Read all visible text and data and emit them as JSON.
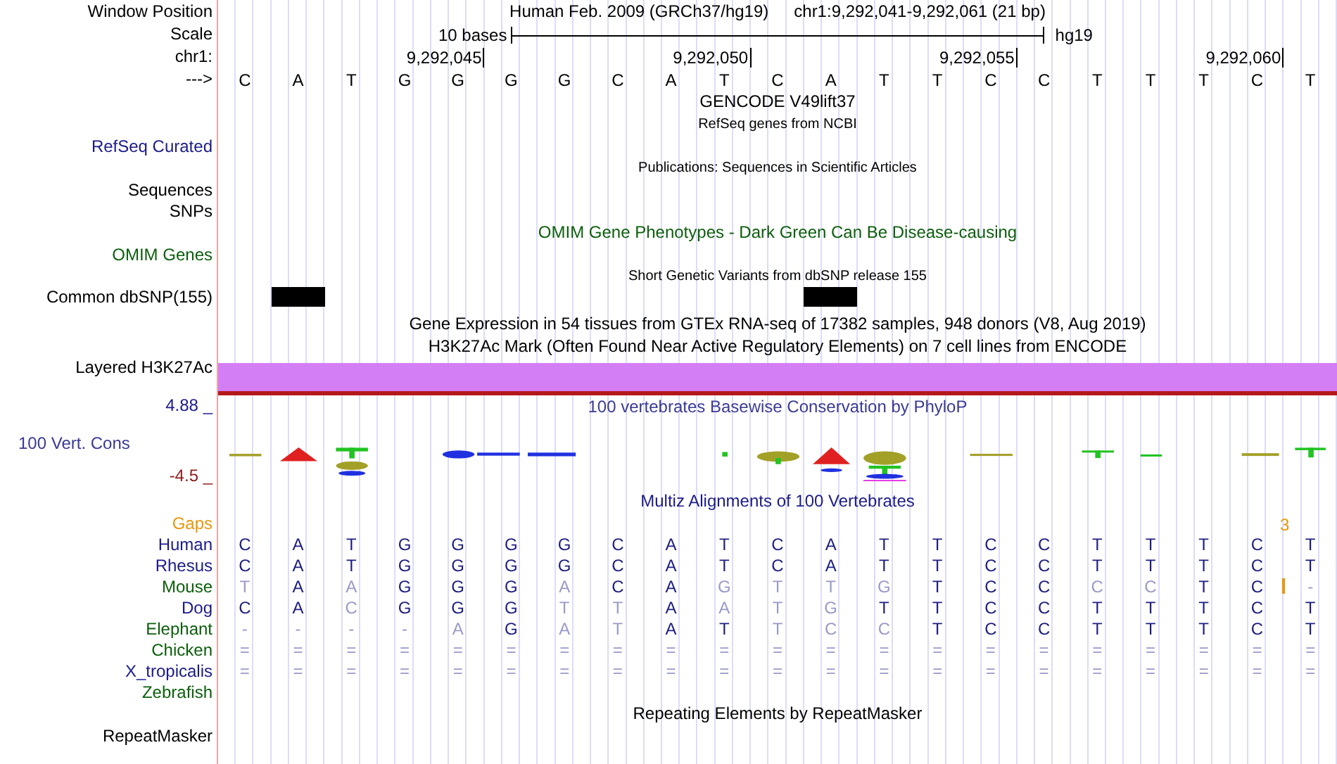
{
  "header": {
    "labels": {
      "window_position": "Window Position",
      "scale": "Scale",
      "chromosome": "chr1:",
      "strand": "--->"
    },
    "assembly": "Human Feb. 2009 (GRCh37/hg19)",
    "position": "chr1:9,292,041-9,292,061 (21 bp)",
    "scale_text": "10 bases",
    "scale_assembly": "hg19",
    "ticks": [
      "9,292,045",
      "9,292,050",
      "9,292,055",
      "9,292,060"
    ],
    "bases": [
      "C",
      "A",
      "T",
      "G",
      "G",
      "G",
      "G",
      "C",
      "A",
      "T",
      "C",
      "A",
      "T",
      "T",
      "C",
      "C",
      "T",
      "T",
      "T",
      "C",
      "T"
    ]
  },
  "tracks": [
    {
      "kind": "title",
      "text": "GENCODE V49lift37",
      "color": "#000000"
    },
    {
      "kind": "subtitle",
      "text": "RefSeq genes from NCBI",
      "color": "#000000"
    },
    {
      "kind": "label",
      "label": "RefSeq Curated",
      "color": "#1b1b8a"
    },
    {
      "kind": "subtitle",
      "text": "Publications: Sequences in Scientific Articles",
      "color": "#000000"
    },
    {
      "kind": "label",
      "label": "Sequences",
      "color": "#000000"
    },
    {
      "kind": "label",
      "label": "SNPs",
      "color": "#000000"
    },
    {
      "kind": "title",
      "text": "OMIM Gene Phenotypes - Dark Green Can Be Disease-causing",
      "color": "#0b5e0b"
    },
    {
      "kind": "label",
      "label": "OMIM Genes",
      "color": "#0b5e0b"
    },
    {
      "kind": "subtitle",
      "text": "Short Genetic Variants from dbSNP release 155",
      "color": "#000000"
    },
    {
      "kind": "snp",
      "label": "Common dbSNP(155)",
      "color": "#000000",
      "variants": [
        {
          "variant": false
        },
        {
          "variant": true
        },
        {
          "variant": false
        },
        {
          "variant": false
        },
        {
          "variant": false
        },
        {
          "variant": false
        },
        {
          "variant": false
        },
        {
          "variant": false
        },
        {
          "variant": false
        },
        {
          "variant": false
        },
        {
          "variant": false
        },
        {
          "variant": true
        },
        {
          "variant": false
        },
        {
          "variant": false
        },
        {
          "variant": false
        },
        {
          "variant": false
        },
        {
          "variant": false
        },
        {
          "variant": false
        },
        {
          "variant": false
        },
        {
          "variant": false
        },
        {
          "variant": false
        }
      ]
    },
    {
      "kind": "title",
      "text": "Gene Expression in 54 tissues from GTEx RNA-seq of 17382 samples, 948 donors (V8, Aug 2019)",
      "color": "#000000"
    },
    {
      "kind": "title",
      "text": "H3K27Ac Mark (Often Found Near Active Regulatory Elements) on 7 cell lines from ENCODE",
      "color": "#000000"
    },
    {
      "kind": "signal",
      "label": "Layered H3K27Ac",
      "color": "#000000"
    },
    {
      "kind": "conservation",
      "label": "100 Vert. Cons",
      "color": "#3a3a96",
      "title": "100 vertebrates Basewise Conservation by PhyloP",
      "max": "4.88 _",
      "min": "-4.5 _"
    },
    {
      "kind": "title",
      "text": "Multiz Alignments of 100 Vertebrates",
      "color": "#1b1b8a"
    },
    {
      "kind": "gaps",
      "label": "Gaps",
      "color": "#e8960c",
      "marker": "3"
    },
    {
      "kind": "species",
      "label": "Human",
      "color": "#1b1b8a",
      "insertion": false,
      "bases": [
        {
          "base": "C",
          "match": true
        },
        {
          "base": "A",
          "match": true
        },
        {
          "base": "T",
          "match": true
        },
        {
          "base": "G",
          "match": true
        },
        {
          "base": "G",
          "match": true
        },
        {
          "base": "G",
          "match": true
        },
        {
          "base": "G",
          "match": true
        },
        {
          "base": "C",
          "match": true
        },
        {
          "base": "A",
          "match": true
        },
        {
          "base": "T",
          "match": true
        },
        {
          "base": "C",
          "match": true
        },
        {
          "base": "A",
          "match": true
        },
        {
          "base": "T",
          "match": true
        },
        {
          "base": "T",
          "match": true
        },
        {
          "base": "C",
          "match": true
        },
        {
          "base": "C",
          "match": true
        },
        {
          "base": "T",
          "match": true
        },
        {
          "base": "T",
          "match": true
        },
        {
          "base": "T",
          "match": true
        },
        {
          "base": "C",
          "match": true
        },
        {
          "base": "T",
          "match": true
        }
      ]
    },
    {
      "kind": "species",
      "label": "Rhesus",
      "color": "#1b1b8a",
      "insertion": false,
      "bases": [
        {
          "base": "C",
          "match": true
        },
        {
          "base": "A",
          "match": true
        },
        {
          "base": "T",
          "match": true
        },
        {
          "base": "G",
          "match": true
        },
        {
          "base": "G",
          "match": true
        },
        {
          "base": "G",
          "match": true
        },
        {
          "base": "G",
          "match": true
        },
        {
          "base": "C",
          "match": true
        },
        {
          "base": "A",
          "match": true
        },
        {
          "base": "T",
          "match": true
        },
        {
          "base": "C",
          "match": true
        },
        {
          "base": "A",
          "match": true
        },
        {
          "base": "T",
          "match": true
        },
        {
          "base": "T",
          "match": true
        },
        {
          "base": "C",
          "match": true
        },
        {
          "base": "C",
          "match": true
        },
        {
          "base": "T",
          "match": true
        },
        {
          "base": "T",
          "match": true
        },
        {
          "base": "T",
          "match": true
        },
        {
          "base": "C",
          "match": true
        },
        {
          "base": "T",
          "match": true
        }
      ]
    },
    {
      "kind": "species",
      "label": "Mouse",
      "color": "#0b5e0b",
      "insertion": true,
      "bases": [
        {
          "base": "T",
          "match": false
        },
        {
          "base": "A",
          "match": true
        },
        {
          "base": "A",
          "match": false
        },
        {
          "base": "G",
          "match": true
        },
        {
          "base": "G",
          "match": true
        },
        {
          "base": "G",
          "match": true
        },
        {
          "base": "A",
          "match": false
        },
        {
          "base": "C",
          "match": true
        },
        {
          "base": "A",
          "match": true
        },
        {
          "base": "G",
          "match": false
        },
        {
          "base": "T",
          "match": false
        },
        {
          "base": "T",
          "match": false
        },
        {
          "base": "G",
          "match": false
        },
        {
          "base": "T",
          "match": true
        },
        {
          "base": "C",
          "match": true
        },
        {
          "base": "C",
          "match": true
        },
        {
          "base": "C",
          "match": false
        },
        {
          "base": "C",
          "match": false
        },
        {
          "base": "T",
          "match": true
        },
        {
          "base": "C",
          "match": true
        },
        {
          "base": "-",
          "match": false
        }
      ]
    },
    {
      "kind": "species",
      "label": "Dog",
      "color": "#1b1b8a",
      "insertion": false,
      "bases": [
        {
          "base": "C",
          "match": true
        },
        {
          "base": "A",
          "match": true
        },
        {
          "base": "C",
          "match": false
        },
        {
          "base": "G",
          "match": true
        },
        {
          "base": "G",
          "match": true
        },
        {
          "base": "G",
          "match": true
        },
        {
          "base": "T",
          "match": false
        },
        {
          "base": "T",
          "match": false
        },
        {
          "base": "A",
          "match": true
        },
        {
          "base": "A",
          "match": false
        },
        {
          "base": "T",
          "match": false
        },
        {
          "base": "G",
          "match": false
        },
        {
          "base": "T",
          "match": true
        },
        {
          "base": "T",
          "match": true
        },
        {
          "base": "C",
          "match": true
        },
        {
          "base": "C",
          "match": true
        },
        {
          "base": "T",
          "match": true
        },
        {
          "base": "T",
          "match": true
        },
        {
          "base": "T",
          "match": true
        },
        {
          "base": "C",
          "match": true
        },
        {
          "base": "T",
          "match": true
        }
      ]
    },
    {
      "kind": "species",
      "label": "Elephant",
      "color": "#0b5e0b",
      "insertion": false,
      "bases": [
        {
          "base": "-",
          "match": false
        },
        {
          "base": "-",
          "match": false
        },
        {
          "base": "-",
          "match": false
        },
        {
          "base": "-",
          "match": false
        },
        {
          "base": "A",
          "match": false
        },
        {
          "base": "G",
          "match": true
        },
        {
          "base": "A",
          "match": false
        },
        {
          "base": "T",
          "match": false
        },
        {
          "base": "A",
          "match": true
        },
        {
          "base": "T",
          "match": true
        },
        {
          "base": "T",
          "match": false
        },
        {
          "base": "C",
          "match": false
        },
        {
          "base": "C",
          "match": false
        },
        {
          "base": "T",
          "match": true
        },
        {
          "base": "C",
          "match": true
        },
        {
          "base": "C",
          "match": true
        },
        {
          "base": "T",
          "match": true
        },
        {
          "base": "T",
          "match": true
        },
        {
          "base": "T",
          "match": true
        },
        {
          "base": "C",
          "match": true
        },
        {
          "base": "T",
          "match": true
        }
      ]
    },
    {
      "kind": "species",
      "label": "Chicken",
      "color": "#0b5e0b",
      "insertion": false,
      "bases": [
        {
          "base": "=",
          "match": false
        },
        {
          "base": "=",
          "match": false
        },
        {
          "base": "=",
          "match": false
        },
        {
          "base": "=",
          "match": false
        },
        {
          "base": "=",
          "match": false
        },
        {
          "base": "=",
          "match": false
        },
        {
          "base": "=",
          "match": false
        },
        {
          "base": "=",
          "match": false
        },
        {
          "base": "=",
          "match": false
        },
        {
          "base": "=",
          "match": false
        },
        {
          "base": "=",
          "match": false
        },
        {
          "base": "=",
          "match": false
        },
        {
          "base": "=",
          "match": false
        },
        {
          "base": "=",
          "match": false
        },
        {
          "base": "=",
          "match": false
        },
        {
          "base": "=",
          "match": false
        },
        {
          "base": "=",
          "match": false
        },
        {
          "base": "=",
          "match": false
        },
        {
          "base": "=",
          "match": false
        },
        {
          "base": "=",
          "match": false
        },
        {
          "base": "=",
          "match": false
        }
      ]
    },
    {
      "kind": "species",
      "label": "X_tropicalis",
      "color": "#1b1b8a",
      "insertion": false,
      "bases": [
        {
          "base": "=",
          "match": false
        },
        {
          "base": "=",
          "match": false
        },
        {
          "base": "=",
          "match": false
        },
        {
          "base": "=",
          "match": false
        },
        {
          "base": "=",
          "match": false
        },
        {
          "base": "=",
          "match": false
        },
        {
          "base": "=",
          "match": false
        },
        {
          "base": "=",
          "match": false
        },
        {
          "base": "=",
          "match": false
        },
        {
          "base": "=",
          "match": false
        },
        {
          "base": "=",
          "match": false
        },
        {
          "base": "=",
          "match": false
        },
        {
          "base": "=",
          "match": false
        },
        {
          "base": "=",
          "match": false
        },
        {
          "base": "=",
          "match": false
        },
        {
          "base": "=",
          "match": false
        },
        {
          "base": "=",
          "match": false
        },
        {
          "base": "=",
          "match": false
        },
        {
          "base": "=",
          "match": false
        },
        {
          "base": "=",
          "match": false
        },
        {
          "base": "=",
          "match": false
        }
      ]
    },
    {
      "kind": "species",
      "label": "Zebrafish",
      "color": "#0b5e0b"
    },
    {
      "kind": "title",
      "text": "Repeating Elements by RepeatMasker",
      "color": "#000000"
    },
    {
      "kind": "label",
      "label": "RepeatMasker",
      "color": "#000000"
    }
  ]
}
